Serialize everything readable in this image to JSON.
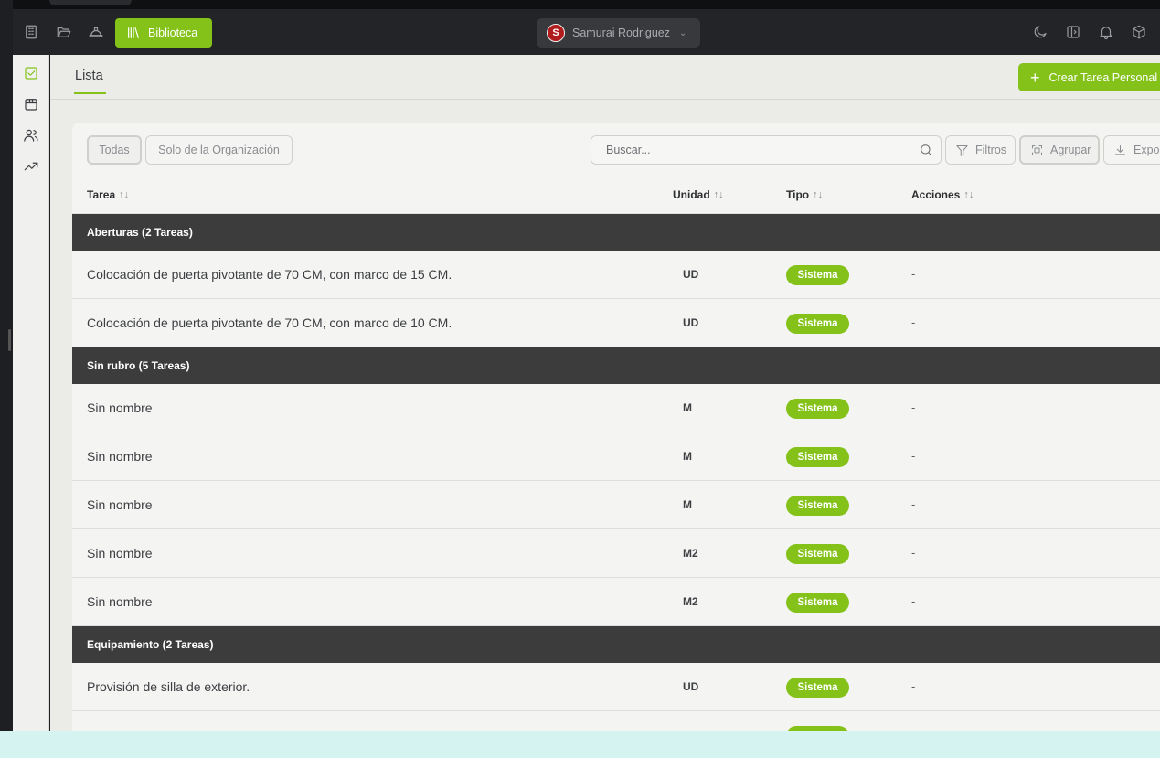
{
  "topbar": {
    "library_label": "Biblioteca",
    "user_initial": "S",
    "user_name": "Samurai Rodriguez"
  },
  "subheader": {
    "tab_label": "Lista",
    "create_button_label": "Crear Tarea Personal"
  },
  "filters": {
    "seg_all": "Todas",
    "seg_org": "Solo de la Organización",
    "search_placeholder": "Buscar...",
    "filters_label": "Filtros",
    "group_label": "Agrupar",
    "export_label": "Exportar"
  },
  "table": {
    "columns": {
      "task": "Tarea",
      "unit": "Unidad",
      "type": "Tipo",
      "actions": "Acciones",
      "sort_glyph": "↑↓"
    },
    "groups": [
      {
        "title": "Aberturas (2 Tareas)",
        "rows": [
          {
            "name": "Colocación de puerta pivotante de 70 CM, con marco de 15 CM.",
            "unit": "UD",
            "type": "Sistema",
            "actions": "-"
          },
          {
            "name": "Colocación de puerta pivotante de 70 CM, con marco de 10 CM.",
            "unit": "UD",
            "type": "Sistema",
            "actions": "-"
          }
        ]
      },
      {
        "title": "Sin rubro (5 Tareas)",
        "rows": [
          {
            "name": "Sin nombre",
            "unit": "M",
            "type": "Sistema",
            "actions": "-"
          },
          {
            "name": "Sin nombre",
            "unit": "M",
            "type": "Sistema",
            "actions": "-"
          },
          {
            "name": "Sin nombre",
            "unit": "M",
            "type": "Sistema",
            "actions": "-"
          },
          {
            "name": "Sin nombre",
            "unit": "M2",
            "type": "Sistema",
            "actions": "-"
          },
          {
            "name": "Sin nombre",
            "unit": "M2",
            "type": "Sistema",
            "actions": "-"
          }
        ]
      },
      {
        "title": "Equipamiento (2 Tareas)",
        "rows": [
          {
            "name": "Provisión de silla de exterior.",
            "unit": "UD",
            "type": "Sistema",
            "actions": "-"
          },
          {
            "name": "",
            "unit": "",
            "type": "Sistema",
            "actions": ""
          }
        ]
      }
    ]
  },
  "colors": {
    "accent": "#84c21a",
    "topbar_bg": "#232427",
    "group_bg": "#3c3c3c"
  }
}
